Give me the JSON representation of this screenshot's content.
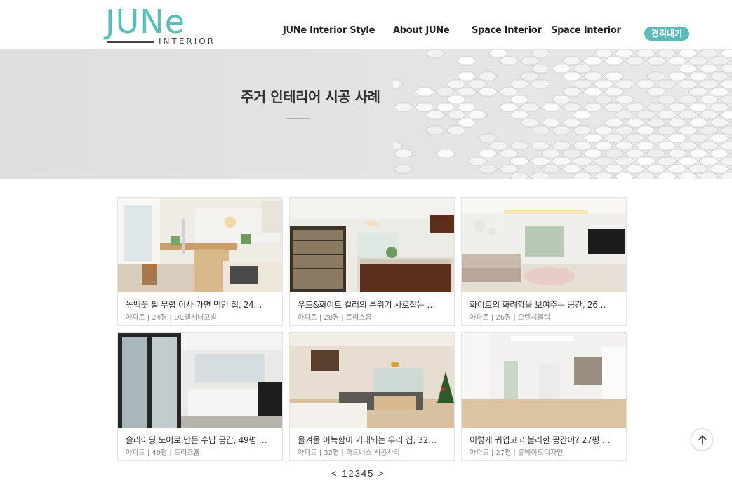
{
  "brand": {
    "logo_text": "JUNe",
    "logo_sub": "INTERIOR",
    "accent_color": "#5bbcbc"
  },
  "nav": {
    "items": [
      {
        "label": "JUNe  Interior Style"
      },
      {
        "label": "About JUNe"
      },
      {
        "label": "Space Interior"
      },
      {
        "label": "Space Interior"
      }
    ],
    "quote_button": "견적내기"
  },
  "banner": {
    "title": "주거 인테리어 시공 사례"
  },
  "portfolio": {
    "cards": [
      {
        "title": "높백꽃 필 무렵 이사 가면 먹인 집, 24…",
        "meta": "아파트 | 24평 | DC엘시내고빌",
        "image": "kitchen-dining-room-photo"
      },
      {
        "title": "우드&화이트 컬러의 분위기 사로잡는 …",
        "meta": "아파트 | 28평 | 트리스홈",
        "image": "kitchen-bookshelf-photo"
      },
      {
        "title": "화이트의 화려함을 보여주는 공간, 26…",
        "meta": "아파트 | 26평 | 오렌시블럭",
        "image": "white-living-room-photo"
      },
      {
        "title": "슬리이딩 도어로 만든 수납 공간, 49평 …",
        "meta": "아파트 | 49평 | 드리즈홈",
        "image": "sliding-door-room-photo"
      },
      {
        "title": "올겨울 이늑함이 기대되는 우리 집, 32…",
        "meta": "아파트 | 32평 | 파드너스 시공사리",
        "image": "cozy-living-room-photo"
      },
      {
        "title": "이렇게 귀엽고 러블리한 공간이? 27평 …",
        "meta": "아파트 | 27평 | 휴메이드디자인",
        "image": "hallway-room-photo"
      }
    ]
  },
  "pagination": {
    "prev": "<",
    "pages": [
      "1",
      "2",
      "3",
      "4",
      "5"
    ],
    "next": ">"
  },
  "scroll_top_icon": "arrow-up-icon"
}
